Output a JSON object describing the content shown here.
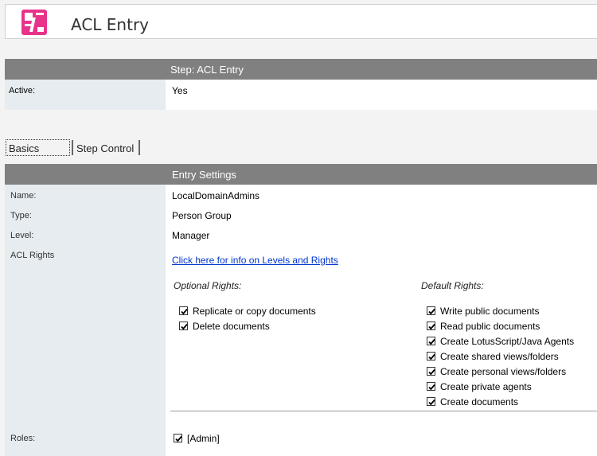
{
  "header": {
    "title": "ACL Entry",
    "logo_icon": "app-logo-icon",
    "logo_color": "#e8338a"
  },
  "step": {
    "label": "Step:  ACL Entry"
  },
  "active": {
    "label": "Active:",
    "value": "Yes"
  },
  "tabs": [
    {
      "label": "Basics",
      "selected": true
    },
    {
      "label": "Step Control",
      "selected": false
    }
  ],
  "entry_settings": {
    "title": "Entry Settings",
    "fields": {
      "name": {
        "label": "Name:",
        "value": "LocalDomainAdmins"
      },
      "type": {
        "label": "Type:",
        "value": "Person Group"
      },
      "level": {
        "label": "Level:",
        "value": "Manager"
      },
      "acl_rights": {
        "label": "ACL Rights",
        "link": "Click here for info on Levels and Rights"
      }
    },
    "optional_rights": {
      "title": "Optional Rights:",
      "items": [
        {
          "label": "Replicate or copy documents",
          "checked": true
        },
        {
          "label": "Delete documents",
          "checked": true
        }
      ]
    },
    "default_rights": {
      "title": "Default Rights:",
      "items": [
        {
          "label": "Write public documents",
          "checked": true
        },
        {
          "label": "Read public documents",
          "checked": true
        },
        {
          "label": "Create LotusScript/Java Agents",
          "checked": true
        },
        {
          "label": "Create shared views/folders",
          "checked": true
        },
        {
          "label": "Create personal views/folders",
          "checked": true
        },
        {
          "label": "Create private agents",
          "checked": true
        },
        {
          "label": "Create documents",
          "checked": true
        }
      ]
    },
    "roles": {
      "label": "Roles:",
      "items": [
        {
          "label": "[Admin]",
          "checked": true
        }
      ]
    }
  },
  "colors": {
    "band": "#808080",
    "label_bg": "#e6ecf0",
    "link": "#0033cc"
  }
}
